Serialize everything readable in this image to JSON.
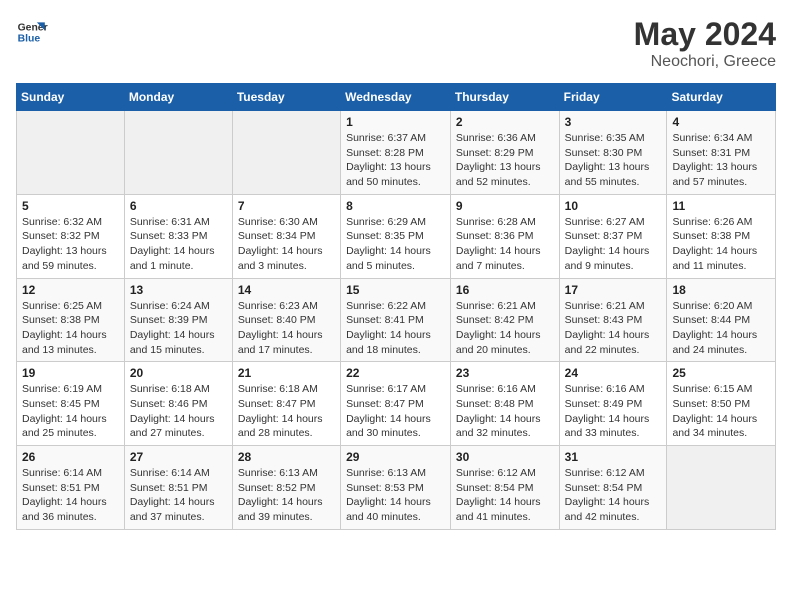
{
  "logo": {
    "line1": "General",
    "line2": "Blue"
  },
  "title": "May 2024",
  "subtitle": "Neochori, Greece",
  "days_of_week": [
    "Sunday",
    "Monday",
    "Tuesday",
    "Wednesday",
    "Thursday",
    "Friday",
    "Saturday"
  ],
  "weeks": [
    [
      {
        "day": "",
        "info": ""
      },
      {
        "day": "",
        "info": ""
      },
      {
        "day": "",
        "info": ""
      },
      {
        "day": "1",
        "info": "Sunrise: 6:37 AM\nSunset: 8:28 PM\nDaylight: 13 hours\nand 50 minutes."
      },
      {
        "day": "2",
        "info": "Sunrise: 6:36 AM\nSunset: 8:29 PM\nDaylight: 13 hours\nand 52 minutes."
      },
      {
        "day": "3",
        "info": "Sunrise: 6:35 AM\nSunset: 8:30 PM\nDaylight: 13 hours\nand 55 minutes."
      },
      {
        "day": "4",
        "info": "Sunrise: 6:34 AM\nSunset: 8:31 PM\nDaylight: 13 hours\nand 57 minutes."
      }
    ],
    [
      {
        "day": "5",
        "info": "Sunrise: 6:32 AM\nSunset: 8:32 PM\nDaylight: 13 hours\nand 59 minutes."
      },
      {
        "day": "6",
        "info": "Sunrise: 6:31 AM\nSunset: 8:33 PM\nDaylight: 14 hours\nand 1 minute."
      },
      {
        "day": "7",
        "info": "Sunrise: 6:30 AM\nSunset: 8:34 PM\nDaylight: 14 hours\nand 3 minutes."
      },
      {
        "day": "8",
        "info": "Sunrise: 6:29 AM\nSunset: 8:35 PM\nDaylight: 14 hours\nand 5 minutes."
      },
      {
        "day": "9",
        "info": "Sunrise: 6:28 AM\nSunset: 8:36 PM\nDaylight: 14 hours\nand 7 minutes."
      },
      {
        "day": "10",
        "info": "Sunrise: 6:27 AM\nSunset: 8:37 PM\nDaylight: 14 hours\nand 9 minutes."
      },
      {
        "day": "11",
        "info": "Sunrise: 6:26 AM\nSunset: 8:38 PM\nDaylight: 14 hours\nand 11 minutes."
      }
    ],
    [
      {
        "day": "12",
        "info": "Sunrise: 6:25 AM\nSunset: 8:38 PM\nDaylight: 14 hours\nand 13 minutes."
      },
      {
        "day": "13",
        "info": "Sunrise: 6:24 AM\nSunset: 8:39 PM\nDaylight: 14 hours\nand 15 minutes."
      },
      {
        "day": "14",
        "info": "Sunrise: 6:23 AM\nSunset: 8:40 PM\nDaylight: 14 hours\nand 17 minutes."
      },
      {
        "day": "15",
        "info": "Sunrise: 6:22 AM\nSunset: 8:41 PM\nDaylight: 14 hours\nand 18 minutes."
      },
      {
        "day": "16",
        "info": "Sunrise: 6:21 AM\nSunset: 8:42 PM\nDaylight: 14 hours\nand 20 minutes."
      },
      {
        "day": "17",
        "info": "Sunrise: 6:21 AM\nSunset: 8:43 PM\nDaylight: 14 hours\nand 22 minutes."
      },
      {
        "day": "18",
        "info": "Sunrise: 6:20 AM\nSunset: 8:44 PM\nDaylight: 14 hours\nand 24 minutes."
      }
    ],
    [
      {
        "day": "19",
        "info": "Sunrise: 6:19 AM\nSunset: 8:45 PM\nDaylight: 14 hours\nand 25 minutes."
      },
      {
        "day": "20",
        "info": "Sunrise: 6:18 AM\nSunset: 8:46 PM\nDaylight: 14 hours\nand 27 minutes."
      },
      {
        "day": "21",
        "info": "Sunrise: 6:18 AM\nSunset: 8:47 PM\nDaylight: 14 hours\nand 28 minutes."
      },
      {
        "day": "22",
        "info": "Sunrise: 6:17 AM\nSunset: 8:47 PM\nDaylight: 14 hours\nand 30 minutes."
      },
      {
        "day": "23",
        "info": "Sunrise: 6:16 AM\nSunset: 8:48 PM\nDaylight: 14 hours\nand 32 minutes."
      },
      {
        "day": "24",
        "info": "Sunrise: 6:16 AM\nSunset: 8:49 PM\nDaylight: 14 hours\nand 33 minutes."
      },
      {
        "day": "25",
        "info": "Sunrise: 6:15 AM\nSunset: 8:50 PM\nDaylight: 14 hours\nand 34 minutes."
      }
    ],
    [
      {
        "day": "26",
        "info": "Sunrise: 6:14 AM\nSunset: 8:51 PM\nDaylight: 14 hours\nand 36 minutes."
      },
      {
        "day": "27",
        "info": "Sunrise: 6:14 AM\nSunset: 8:51 PM\nDaylight: 14 hours\nand 37 minutes."
      },
      {
        "day": "28",
        "info": "Sunrise: 6:13 AM\nSunset: 8:52 PM\nDaylight: 14 hours\nand 39 minutes."
      },
      {
        "day": "29",
        "info": "Sunrise: 6:13 AM\nSunset: 8:53 PM\nDaylight: 14 hours\nand 40 minutes."
      },
      {
        "day": "30",
        "info": "Sunrise: 6:12 AM\nSunset: 8:54 PM\nDaylight: 14 hours\nand 41 minutes."
      },
      {
        "day": "31",
        "info": "Sunrise: 6:12 AM\nSunset: 8:54 PM\nDaylight: 14 hours\nand 42 minutes."
      },
      {
        "day": "",
        "info": ""
      }
    ]
  ]
}
